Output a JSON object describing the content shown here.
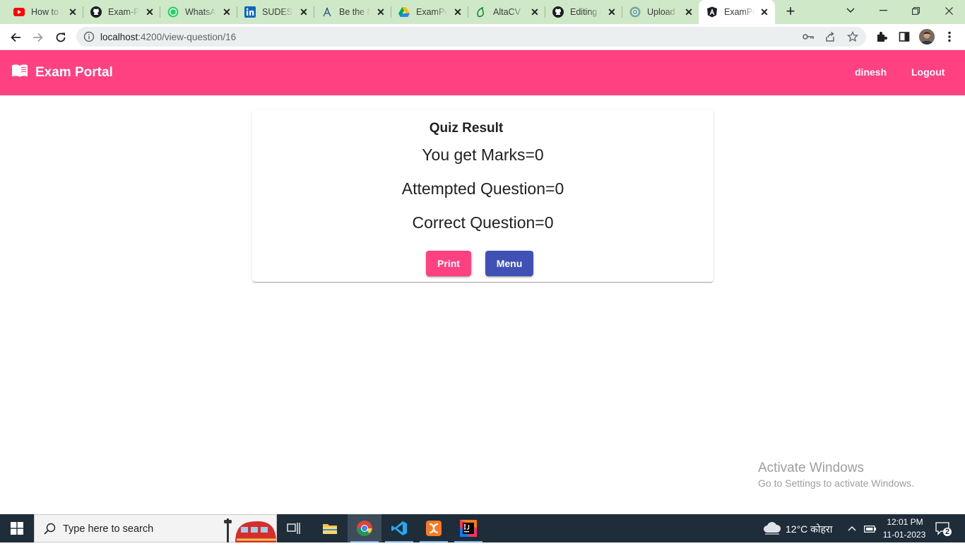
{
  "browser": {
    "tabs": [
      {
        "title": "How to c",
        "icon": "youtube-icon"
      },
      {
        "title": "Exam-Po",
        "icon": "github-icon"
      },
      {
        "title": "WhatsAp",
        "icon": "whatsapp-icon"
      },
      {
        "title": "SUDESH",
        "icon": "linkedin-icon"
      },
      {
        "title": "Be the N",
        "icon": "hackerrank-icon"
      },
      {
        "title": "ExamPor",
        "icon": "google-drive-icon"
      },
      {
        "title": "AltaCV |",
        "icon": "overleaf-icon"
      },
      {
        "title": "Editing C",
        "icon": "github-icon"
      },
      {
        "title": "Upload |",
        "icon": "openai-icon"
      },
      {
        "title": "ExamPor",
        "icon": "angular-icon",
        "active": true
      }
    ],
    "url_host": "localhost",
    "url_rest": ":4200/view-question/16"
  },
  "app": {
    "brand": "Exam Portal",
    "username": "dinesh",
    "logout": "Logout",
    "header_color": "#ff4081"
  },
  "result": {
    "title": "Quiz Result",
    "marks": "You get Marks=0",
    "attempted": "Attempted Question=0",
    "correct": "Correct Question=0",
    "print_label": "Print",
    "menu_label": "Menu",
    "accent": "#ff4081",
    "primary": "#3f51b5"
  },
  "watermark": {
    "line1": "Activate Windows",
    "line2": "Go to Settings to activate Windows."
  },
  "taskbar": {
    "search_placeholder": "Type here to search",
    "weather": "12°C  कोहरा",
    "time": "12:01 PM",
    "date": "11-01-2023",
    "notifications": "2"
  }
}
